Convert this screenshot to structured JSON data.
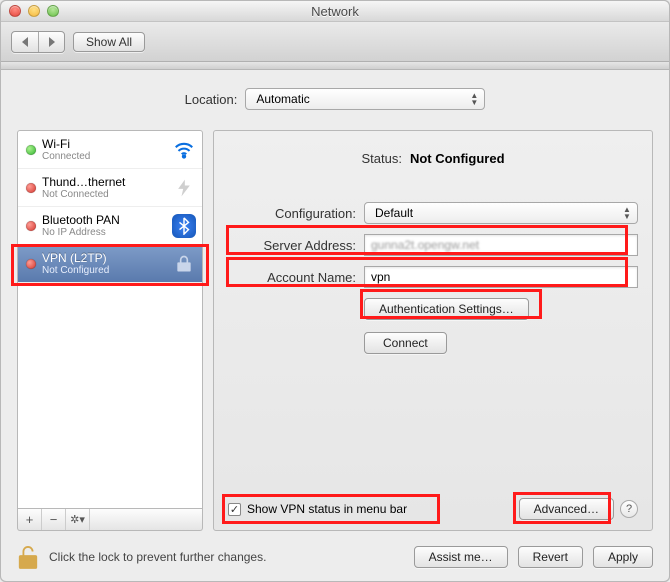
{
  "window": {
    "title": "Network"
  },
  "toolbar": {
    "show_all": "Show All"
  },
  "location": {
    "label": "Location:",
    "value": "Automatic"
  },
  "sidebar": {
    "items": [
      {
        "name": "Wi-Fi",
        "status": "Connected",
        "dot": "green"
      },
      {
        "name": "Thund…thernet",
        "status": "Not Connected",
        "dot": "red"
      },
      {
        "name": "Bluetooth PAN",
        "status": "No IP Address",
        "dot": "red"
      },
      {
        "name": "VPN (L2TP)",
        "status": "Not Configured",
        "dot": "red"
      }
    ],
    "add": "+",
    "remove": "−",
    "gear": "✽▾"
  },
  "detail": {
    "status_label": "Status:",
    "status_value": "Not Configured",
    "config_label": "Configuration:",
    "config_value": "Default",
    "server_label": "Server Address:",
    "server_value": "gunna2t.opengw.net",
    "account_label": "Account Name:",
    "account_value": "vpn",
    "auth_button": "Authentication Settings…",
    "connect_button": "Connect",
    "show_status_label": "Show VPN status in menu bar",
    "show_status_checked": true,
    "advanced_button": "Advanced…"
  },
  "footer": {
    "lock_text": "Click the lock to prevent further changes.",
    "assist": "Assist me…",
    "revert": "Revert",
    "apply": "Apply"
  }
}
